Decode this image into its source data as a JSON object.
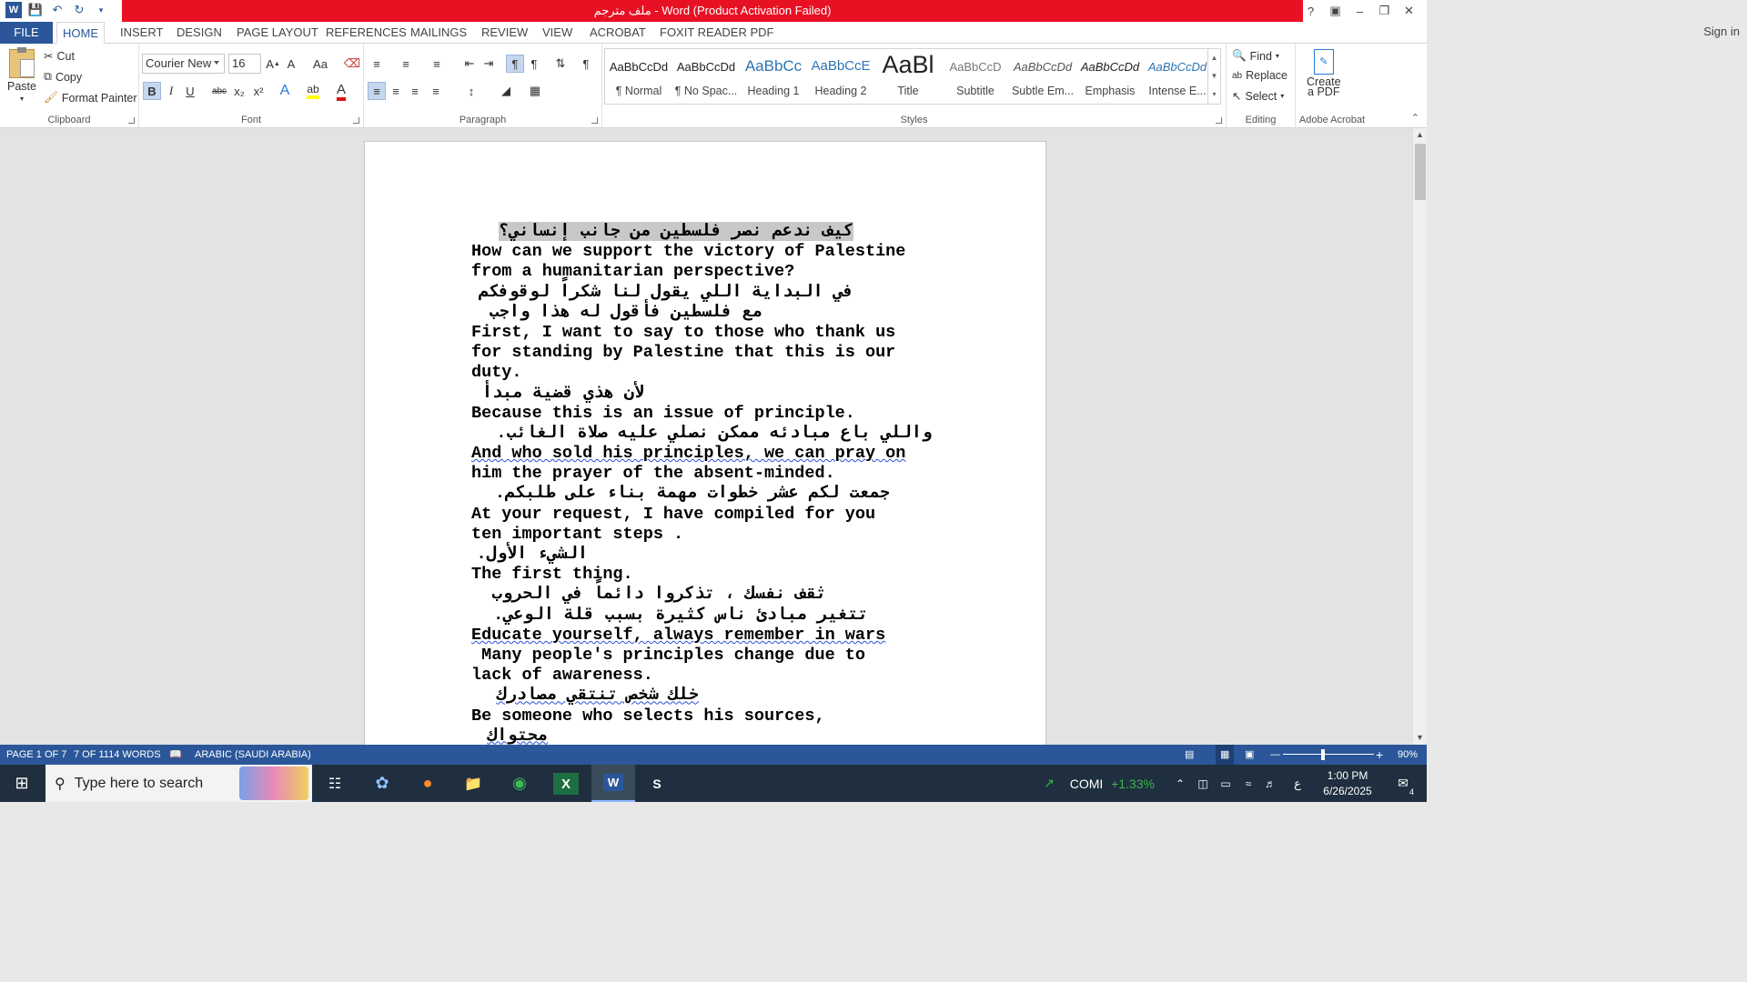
{
  "titlebar": {
    "title": "ملف مترجم  -  Word (Product Activation Failed)",
    "help": "?"
  },
  "tabs": [
    "FILE",
    "HOME",
    "INSERT",
    "DESIGN",
    "PAGE LAYOUT",
    "REFERENCES",
    "MAILINGS",
    "REVIEW",
    "VIEW",
    "ACROBAT",
    "FOXIT READER PDF"
  ],
  "signin": "Sign in",
  "clipboard": {
    "paste": "Paste",
    "cut": "Cut",
    "copy": "Copy",
    "format_painter": "Format Painter",
    "label": "Clipboard"
  },
  "font": {
    "name": "Courier New",
    "size": "16",
    "label": "Font",
    "change_case": "Aa",
    "bold": "B",
    "italic": "I",
    "underline": "U",
    "strike": "abc",
    "sub": "x₂",
    "sup": "x²"
  },
  "paragraph": {
    "label": "Paragraph"
  },
  "styles": {
    "label": "Styles",
    "items": [
      {
        "sample": "AaBbCcDd",
        "name": "¶ Normal"
      },
      {
        "sample": "AaBbCcDd",
        "name": "¶ No Spac..."
      },
      {
        "sample": "AaBbCc",
        "name": "Heading 1"
      },
      {
        "sample": "AaBbCcE",
        "name": "Heading 2"
      },
      {
        "sample": "AaBl",
        "name": "Title"
      },
      {
        "sample": "AaBbCcD",
        "name": "Subtitle"
      },
      {
        "sample": "AaBbCcDd",
        "name": "Subtle Em..."
      },
      {
        "sample": "AaBbCcDd",
        "name": "Emphasis"
      },
      {
        "sample": "AaBbCcDd",
        "name": "Intense E..."
      }
    ]
  },
  "editing": {
    "find": "Find",
    "replace": "Replace",
    "select": "Select",
    "label": "Editing"
  },
  "acrobat": {
    "create": "Create",
    "pdf": "a PDF",
    "label": "Adobe Acrobat"
  },
  "document": {
    "lines": [
      "كيف ندعم نصر فلسطين من جانب إنساني؟",
      "How can we support the victory of Palestine",
      "from a humanitarian perspective?",
      "في البداية اللي يقول لنا شكراً لوقوفكم",
      "مع فلسطين فأقول له هذا واجب",
      "First, I want to say to those who thank us",
      "for standing by Palestine that this is our",
      "duty.",
      "لأن هذي قضية مبدأ",
      "Because this is an issue of principle.",
      "واللي باع مبادئه ممكن نصلي عليه صلاة الغائب.",
      "And who sold his principles, we can pray on",
      "him the prayer of the absent-minded.",
      "جمعت لكم عشر خطوات مهمة بناء على طلبكم.",
      "At your request, I have compiled for you",
      "ten important steps .",
      "الشيء الأول.",
      "The first thing.",
      "ثقف نفسك ، تذكروا دائماً في الحروب",
      "تتغير مبادئ ناس كثيرة بسبب قلة الوعي.",
      "Educate yourself, always remember in wars",
      " Many people's principles change due to",
      "lack of awareness.",
      "خلك شخص تنتقي مصادرك",
      "Be someone who selects his sources,",
      "محتواك"
    ]
  },
  "status": {
    "page": "PAGE 1 OF 7",
    "words": "7 OF 1114 WORDS",
    "language": "ARABIC (SAUDI ARABIA)",
    "zoom": "90%"
  },
  "taskbar": {
    "search_placeholder": "Type here to search",
    "ticker": "COMI",
    "change": "+1.33%",
    "lang": "ع",
    "time": "1:00 PM",
    "date": "6/26/2025",
    "notif": "4"
  },
  "colors": {
    "accent": "#2b579a",
    "error_bar": "#e81123",
    "taskbar": "#1f2f3f"
  }
}
